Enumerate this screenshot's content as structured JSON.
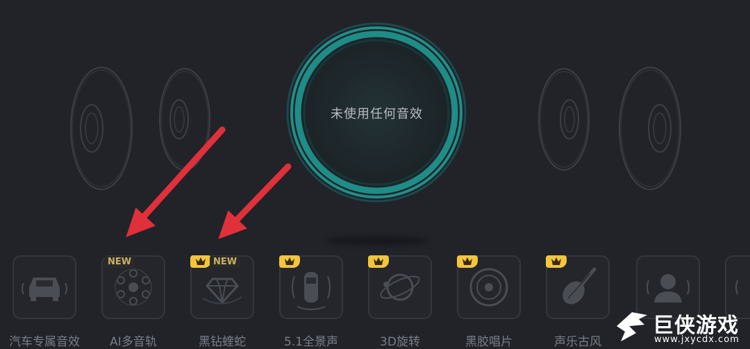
{
  "status_text": "未使用任何音效",
  "effects": [
    {
      "label": "汽车专属音效",
      "icon": "car-icon",
      "badge_new": "",
      "vip": false
    },
    {
      "label": "AI多音轨",
      "icon": "ai-multitrack-icon",
      "badge_new": "NEW",
      "vip": false
    },
    {
      "label": "黑钻蝰蛇",
      "icon": "diamond-icon",
      "badge_new": "NEW",
      "vip": true
    },
    {
      "label": "5.1全景声",
      "icon": "surround-car-icon",
      "badge_new": "",
      "vip": true
    },
    {
      "label": "3D旋转",
      "icon": "orbit-icon",
      "badge_new": "",
      "vip": true
    },
    {
      "label": "黑胶唱片",
      "icon": "vinyl-icon",
      "badge_new": "",
      "vip": true
    },
    {
      "label": "声乐古风",
      "icon": "pipa-icon",
      "badge_new": "",
      "vip": true
    },
    {
      "label": "",
      "icon": "person-icon",
      "badge_new": "",
      "vip": false
    },
    {
      "label": "",
      "icon": "partial-tile-icon",
      "badge_new": "",
      "vip": false
    }
  ],
  "watermark": {
    "title": "巨侠游戏",
    "url": "www.jxycdx.com"
  },
  "colors": {
    "background": "#212329",
    "ring": "#1f8f8a",
    "arrow": "#e0303a",
    "vip_badge": "#f2c53d"
  }
}
